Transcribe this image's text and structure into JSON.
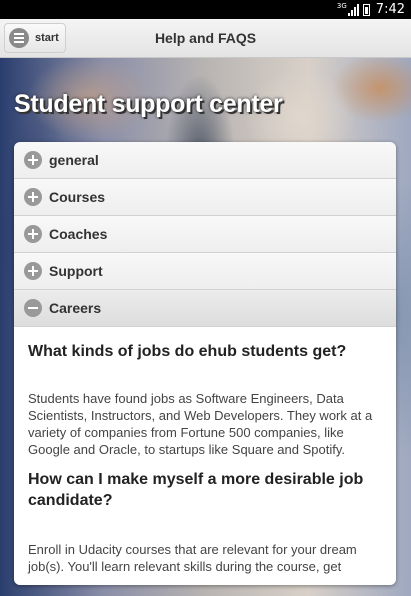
{
  "status_bar": {
    "network": "3G",
    "time": "7:42"
  },
  "header": {
    "start_label": "start",
    "title": "Help and FAQS"
  },
  "hero": {
    "title": "Student support center"
  },
  "accordion": {
    "items": [
      {
        "label": "general",
        "expanded": false
      },
      {
        "label": "Courses",
        "expanded": false
      },
      {
        "label": "Coaches",
        "expanded": false
      },
      {
        "label": "Support",
        "expanded": false
      },
      {
        "label": "Careers",
        "expanded": true
      }
    ],
    "careers_content": {
      "q1": "What kinds of jobs do ehub students get?",
      "a1": "Students have found jobs as Software Engineers, Data Scientists, Instructors, and Web Developers. They work at a variety of companies from Fortune 500 companies, like Google and Oracle, to startups like Square and Spotify.",
      "q2": "How can I make myself a more desirable job candidate?",
      "a2": "Enroll in Udacity courses that are relevant for your dream job(s). You'll learn relevant skills during the course, get"
    }
  }
}
